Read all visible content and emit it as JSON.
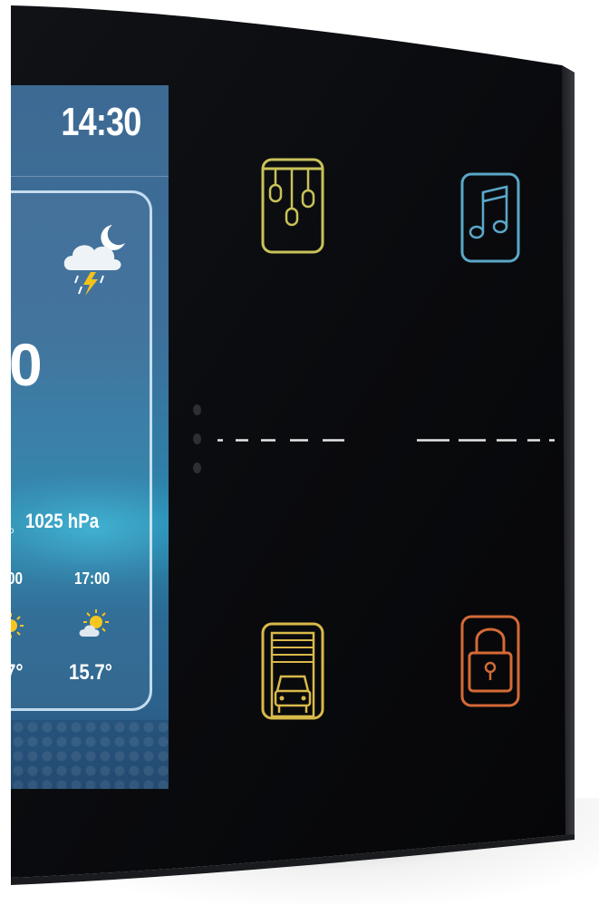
{
  "screen": {
    "clock": "14:30",
    "current_temp_partial": "0",
    "pressure": "1025 hPa",
    "forecast": [
      {
        "time": "00",
        "temp": "7°"
      },
      {
        "time": "17:00",
        "temp": "15.7°"
      }
    ]
  },
  "buttons": [
    {
      "name": "lights",
      "icon": "chandelier-lights-icon",
      "color": "#c9c25a"
    },
    {
      "name": "music",
      "icon": "music-note-icon",
      "color": "#5aa7c8"
    },
    {
      "name": "garage",
      "icon": "garage-car-icon",
      "color": "#d9b94a"
    },
    {
      "name": "lock",
      "icon": "padlock-icon",
      "color": "#d46a36"
    }
  ],
  "colors": {
    "panel_glass": "#0b0c10",
    "screen_blue": "#3c6f9a",
    "divider": "#e6e6e6"
  }
}
